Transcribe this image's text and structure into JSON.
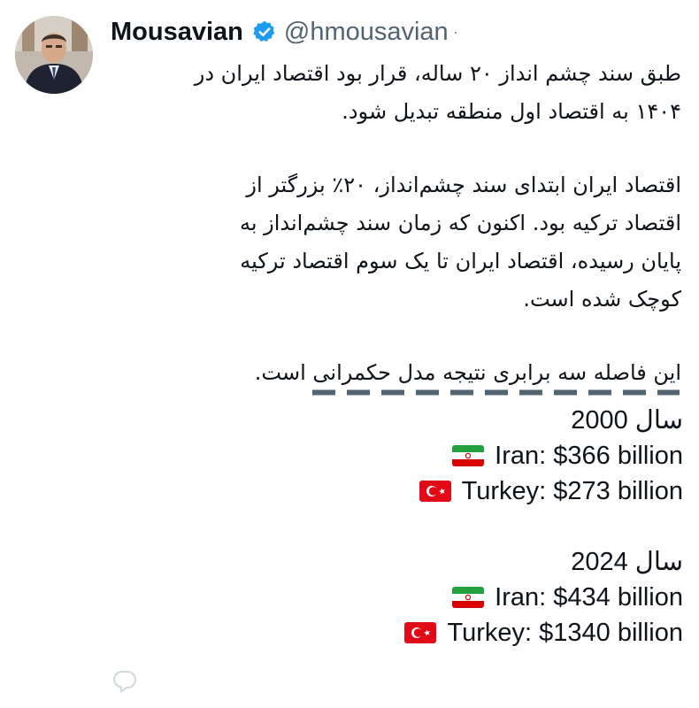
{
  "author": {
    "name": "Mousavian",
    "handle": "@hmousavian",
    "verified": true,
    "more_indicator": "·"
  },
  "tweet": {
    "paragraphs": [
      [
        "طبق سند چشم انداز ۲۰ ساله، قرار بود اقتصاد ایران در",
        "۱۴۰۴ به اقتصاد اول منطقه تبدیل شود."
      ],
      [
        "اقتصاد ایران ابتدای سند چشم‌انداز، ۲۰٪ بزرگتر از",
        "اقتصاد ترکیه بود. اکنون که زمان سند چشم‌انداز به",
        "پایان رسیده، اقتصاد ایران تا یک سوم اقتصاد ترکیه",
        "کوچک شده است."
      ],
      [
        "این فاصله سه برابری نتیجه مدل حکمرانی است."
      ]
    ],
    "divider": "dashed",
    "stats": [
      {
        "year_label": "سال 2000",
        "lines": [
          {
            "flag": "iran-flag",
            "text": "Iran: $366 billion"
          },
          {
            "flag": "turkey-flag",
            "text": "Turkey: $273 billion"
          }
        ]
      },
      {
        "year_label": "سال 2024",
        "lines": [
          {
            "flag": "iran-flag",
            "text": "Iran: $434 billion"
          },
          {
            "flag": "turkey-flag",
            "text": "Turkey: $1340 billion"
          }
        ]
      }
    ]
  },
  "actions": {
    "reply_icon": "reply-icon"
  },
  "colors": {
    "text": "#0f1419",
    "secondary": "#536471",
    "verified_badge": "#1d9bf0",
    "divider": "#536471"
  }
}
